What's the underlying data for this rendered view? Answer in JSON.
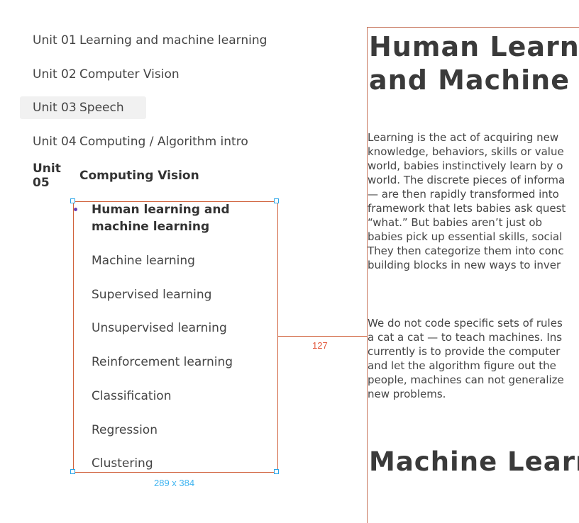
{
  "sidebar": {
    "units": [
      {
        "code": "Unit 01",
        "title": "Learning and machine learning"
      },
      {
        "code": "Unit 02",
        "title": "Computer Vision"
      },
      {
        "code": "Unit 03",
        "title": "Speech"
      },
      {
        "code": "Unit 04",
        "title": "Computing / Algorithm intro"
      },
      {
        "code": "Unit 05",
        "title": "Computing Vision"
      }
    ],
    "selected_unit": "Unit 03",
    "active_unit": "Unit 05",
    "sub_items": [
      "Human learning and machine learning",
      "Machine learning",
      "Supervised learning",
      "Unsupervised learning",
      "Reinforcement learning",
      "Classification",
      "Regression",
      "Clustering"
    ]
  },
  "overlay": {
    "size_label": "289 x 384",
    "distance_label": "127",
    "accent_color": "#d0613b",
    "handle_color": "#2aa5e8"
  },
  "content": {
    "heading_line1": "Human Learnin",
    "heading_line2": "and Machine Le",
    "paragraph1": [
      "Learning is the act of acquiring new",
      "knowledge, behaviors, skills or value",
      "world, babies instinctively learn by o",
      "world. The discrete pieces of informa",
      "— are then rapidly transformed into",
      "framework that lets babies ask quest",
      "“what.” But babies aren’t just ob",
      "babies pick up essential skills, social",
      "They then categorize them into conc",
      "building blocks in new ways to inver"
    ],
    "paragraph2": [
      "We do not code specific sets of rules",
      "a cat a cat — to teach machines. Ins",
      "currently is to provide the computer",
      "and let the algorithm figure out the",
      "people, machines can not generalize",
      "new problems."
    ],
    "heading2": "Machine Learni"
  }
}
